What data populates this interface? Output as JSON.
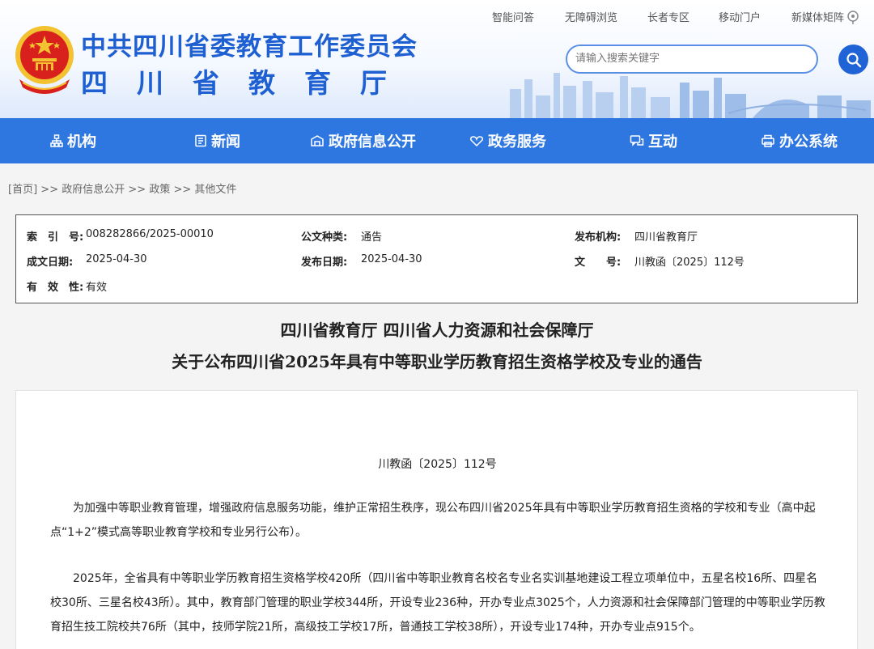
{
  "header": {
    "org_name": "中共四川省委教育工作委员会",
    "dept_name": "四川省教育厅",
    "top_links": [
      "智能问答",
      "无障碍浏览",
      "长者专区",
      "移动门户",
      "新媒体矩阵"
    ],
    "search": {
      "placeholder": "请输入搜索关键字"
    }
  },
  "nav": {
    "items": [
      {
        "label": "机构",
        "icon": "org-chart-icon"
      },
      {
        "label": "新闻",
        "icon": "news-icon"
      },
      {
        "label": "政府信息公开",
        "icon": "gov-info-icon"
      },
      {
        "label": "政务服务",
        "icon": "service-icon"
      },
      {
        "label": "互动",
        "icon": "interaction-icon"
      },
      {
        "label": "办公系统",
        "icon": "office-icon"
      }
    ]
  },
  "breadcrumb": {
    "home": "[首页]",
    "separator": ">>",
    "items": [
      "政府信息公开",
      "政策",
      "其他文件"
    ]
  },
  "info": {
    "index_label": "索　引　号:",
    "index_value": "008282866/2025-00010",
    "category_label": "公文种类:",
    "category_value": "通告",
    "publisher_label": "发布机构:",
    "publisher_value": "四川省教育厅",
    "written_label": "成文日期:",
    "written_value": "2025-04-30",
    "published_label": "发布日期:",
    "published_value": "2025-04-30",
    "docno_label": "文　　号:",
    "docno_value": "川教函〔2025〕112号",
    "validity_label": "有　效　性:",
    "validity_value": "有效"
  },
  "document": {
    "title_line1": "四川省教育厅 四川省人力资源和社会保障厅",
    "title_line2": "关于公布四川省2025年具有中等职业学历教育招生资格学校及专业的通告",
    "doc_number": "川教函〔2025〕112号",
    "para1": "为加强中等职业教育管理，增强政府信息服务功能，维护正常招生秩序，现公布四川省2025年具有中等职业学历教育招生资格的学校和专业（高中起点“1+2”模式高等职业教育学校和专业另行公布）。",
    "para2": "2025年，全省具有中等职业学历教育招生资格学校420所（四川省中等职业教育名校名专业名实训基地建设工程立项单位中，五星名校16所、四星名校30所、三星名校43所）。其中，教育部门管理的职业学校344所，开设专业236种，开办专业点3025个，人力资源和社会保障部门管理的中等职业学历教育招生技工院校共76所（其中，技师学院21所，高级技工学校17所，普通技工学校38所），开设专业174种，开办专业点915个。"
  },
  "colors": {
    "brand_blue": "#1e5fd1",
    "nav_blue": "#2e76e0",
    "emblem_red": "#d8201c",
    "emblem_gold": "#f2c230"
  }
}
